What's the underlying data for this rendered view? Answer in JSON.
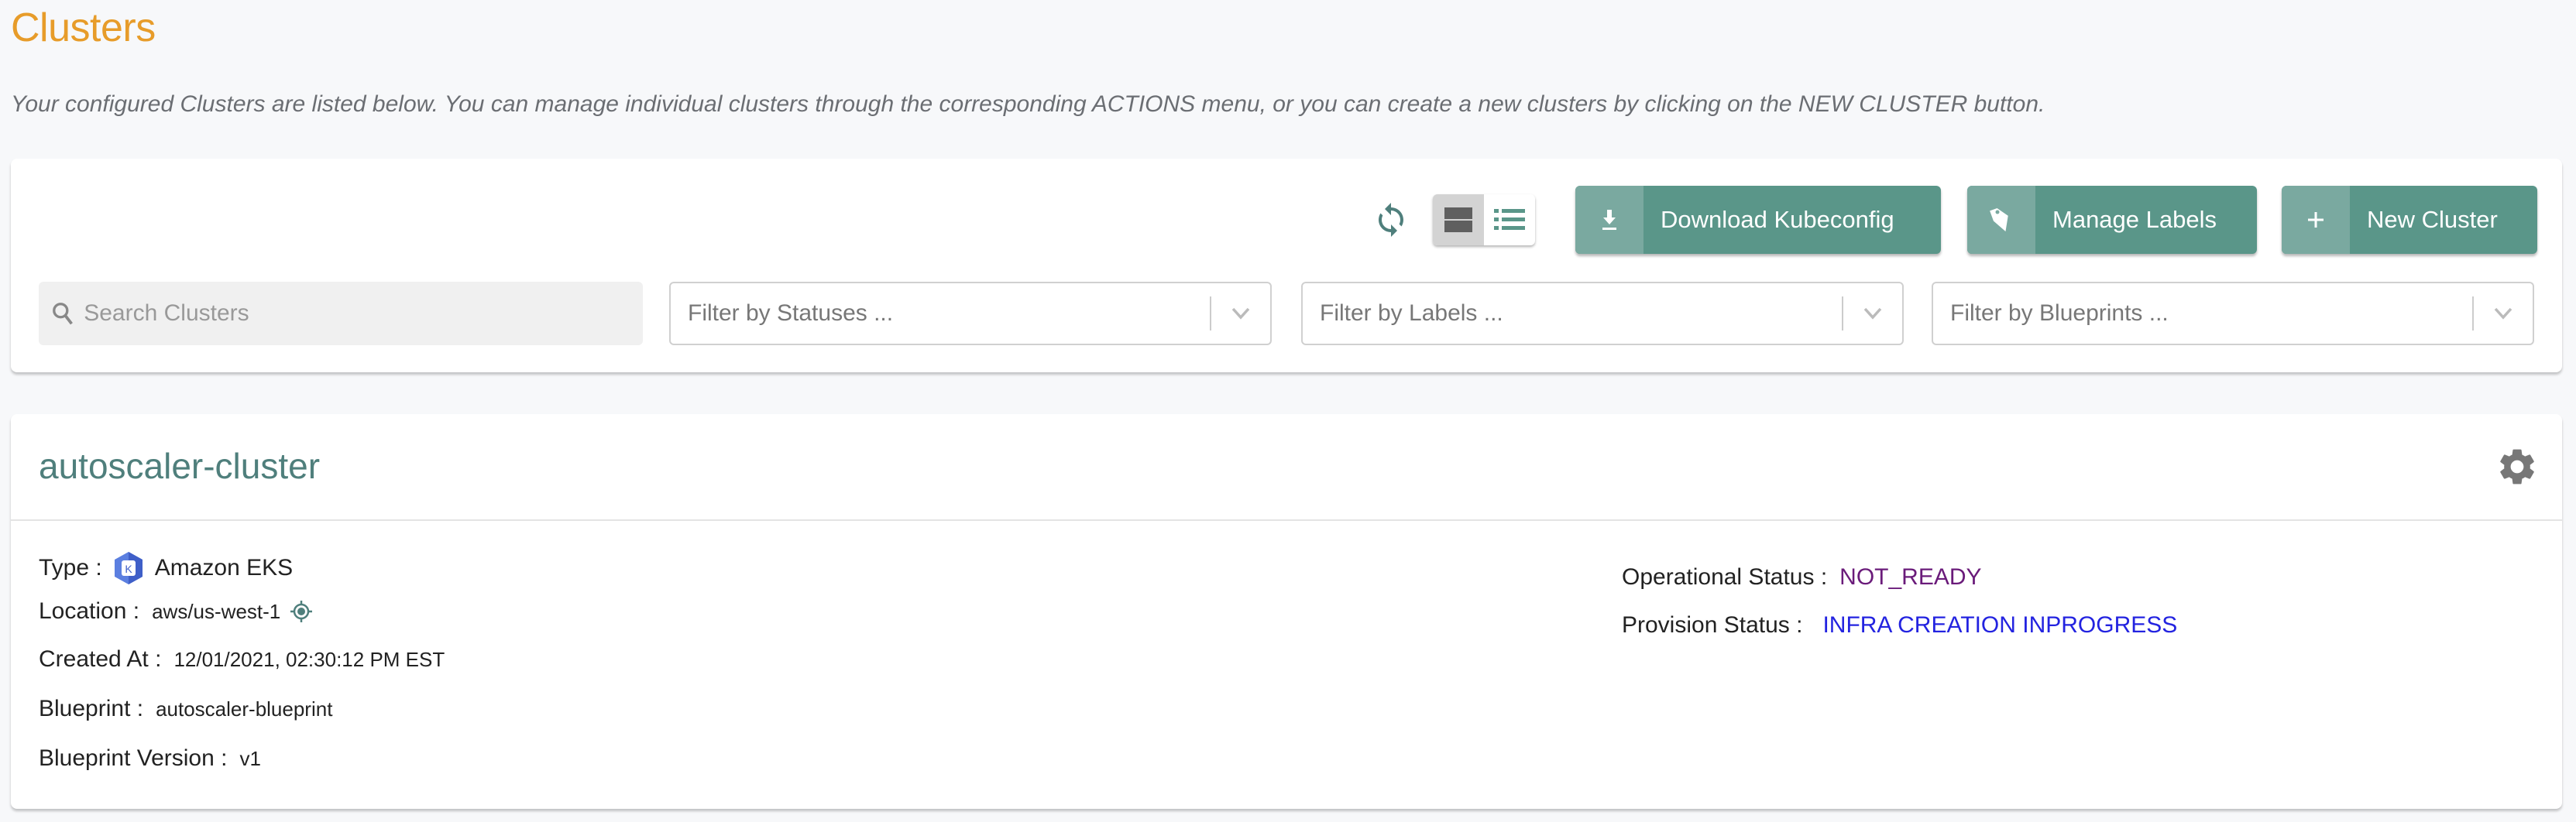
{
  "page": {
    "title": "Clusters",
    "description": "Your configured Clusters are listed below. You can manage individual clusters through the corresponding ACTIONS menu, or you can create a new clusters by clicking on the NEW CLUSTER button."
  },
  "toolbar": {
    "refresh_icon": "refresh-icon",
    "view_modes": [
      {
        "name": "card-view",
        "icon": "grid-view-icon",
        "active": true
      },
      {
        "name": "list-view",
        "icon": "list-view-icon",
        "active": false
      }
    ],
    "buttons": [
      {
        "label": "Download Kubeconfig",
        "icon": "download-icon"
      },
      {
        "label": "Manage Labels",
        "icon": "tag-icon"
      },
      {
        "label": "New Cluster",
        "icon": "plus-icon"
      }
    ],
    "search": {
      "placeholder": "Search Clusters",
      "value": ""
    },
    "filters": [
      {
        "placeholder": "Filter by Statuses ..."
      },
      {
        "placeholder": "Filter by Labels ..."
      },
      {
        "placeholder": "Filter by Blueprints ..."
      }
    ]
  },
  "clusters": [
    {
      "name": "autoscaler-cluster",
      "fields": {
        "type": {
          "label": "Type :",
          "value": "Amazon EKS",
          "icon": "eks-icon"
        },
        "location": {
          "label": "Location :",
          "value": "aws/us-west-1",
          "icon": "location-target-icon"
        },
        "created_at": {
          "label": "Created At :",
          "value": "12/01/2021, 02:30:12 PM EST"
        },
        "blueprint": {
          "label": "Blueprint :",
          "value": "autoscaler-blueprint"
        },
        "blueprint_version": {
          "label": "Blueprint Version :",
          "value": "v1"
        },
        "operational_status": {
          "label": "Operational Status :",
          "value": "NOT_READY",
          "color": "#6a1b7a"
        },
        "provision_status": {
          "label": "Provision Status :",
          "value": "INFRA CREATION INPROGRESS",
          "color": "#2323e0"
        }
      }
    }
  ],
  "colors": {
    "title": "#e79c2a",
    "accent": "#5a9689",
    "accent_light": "#7aa9a0",
    "cluster_name": "#4f7f7c"
  }
}
